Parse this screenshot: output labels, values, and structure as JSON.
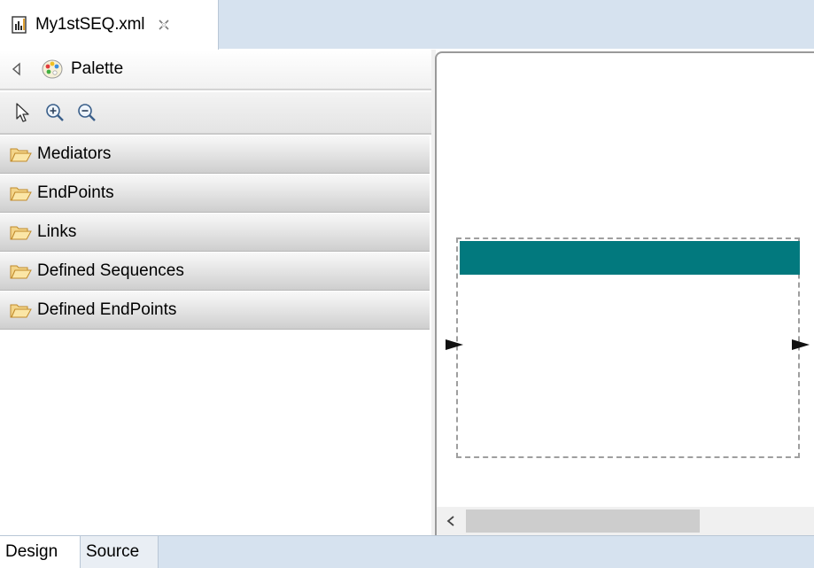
{
  "editor": {
    "tab_title": "My1stSEQ.xml",
    "file_icon": "xml-file-icon",
    "close_icon": "close-icon"
  },
  "palette": {
    "title": "Palette",
    "tools": [
      "select-pointer-icon",
      "zoom-in-icon",
      "zoom-out-icon"
    ],
    "drawers": [
      {
        "label": "Mediators"
      },
      {
        "label": "EndPoints"
      },
      {
        "label": "Links"
      },
      {
        "label": "Defined Sequences"
      },
      {
        "label": "Defined EndPoints"
      }
    ]
  },
  "canvas": {
    "sequence_header_color": "#02797e",
    "arrow_color": "#111111",
    "scroll_left_icon": "chevron-left-icon"
  },
  "bottom_tabs": [
    {
      "label": "Design",
      "active": true
    },
    {
      "label": "Source",
      "active": false
    }
  ]
}
